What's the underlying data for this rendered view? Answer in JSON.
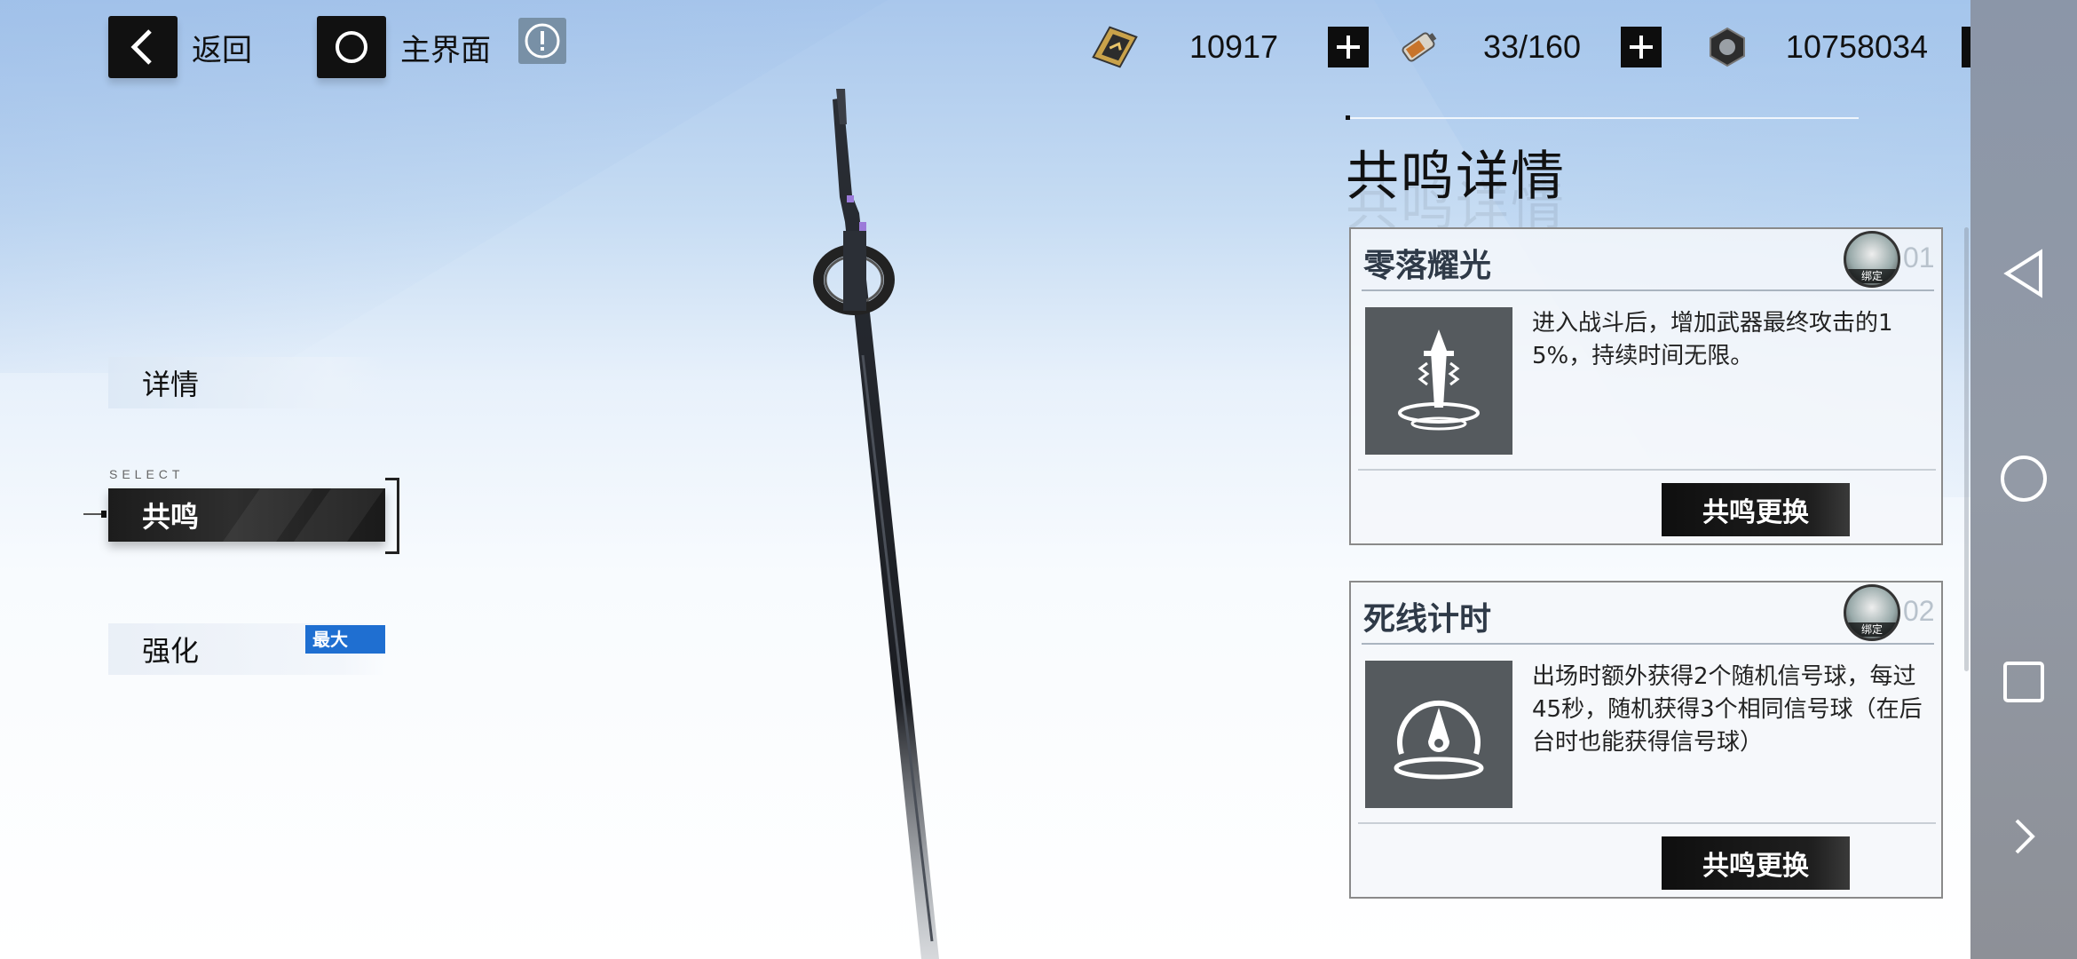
{
  "topbar": {
    "back_label": "返回",
    "home_label": "主界面",
    "back_icon": "chevron-left-icon",
    "home_icon": "circle-icon",
    "info_icon": "exclamation-circle-icon"
  },
  "resources": [
    {
      "name": "resource-energy",
      "icon": "energy-card-icon",
      "value": "10917"
    },
    {
      "name": "resource-stamina",
      "icon": "battery-icon",
      "value": "33/160"
    },
    {
      "name": "resource-coins",
      "icon": "coin-nut-icon",
      "value": "10758034"
    }
  ],
  "tabs": {
    "details": "详情",
    "select_label": "SELECT",
    "resonance": "共鸣",
    "enhance": "强化",
    "enhance_badge": "最大"
  },
  "panel": {
    "title": "共鸣详情",
    "cards": [
      {
        "name": "零落耀光",
        "number": "01",
        "bound_tag": "绑定",
        "icon": "sword-glow-icon",
        "description": "进入战斗后，增加武器最终攻击的15%，持续时间无限。",
        "button": "共鸣更换"
      },
      {
        "name": "死线计时",
        "number": "02",
        "bound_tag": "绑定",
        "icon": "timer-drop-icon",
        "description": "出场时额外获得2个随机信号球，每过45秒，随机获得3个相同信号球（在后台时也能获得信号球）",
        "button": "共鸣更换"
      }
    ]
  },
  "navbar": {
    "back_icon": "triangle-back-icon",
    "home_icon": "circle-home-icon",
    "recent_icon": "square-recent-icon",
    "more_icon": "chevron-right-icon"
  },
  "colors": {
    "badge_blue": "#1f6fd1",
    "dark_button": "#111111",
    "nav_gray": "#8f96a3"
  }
}
